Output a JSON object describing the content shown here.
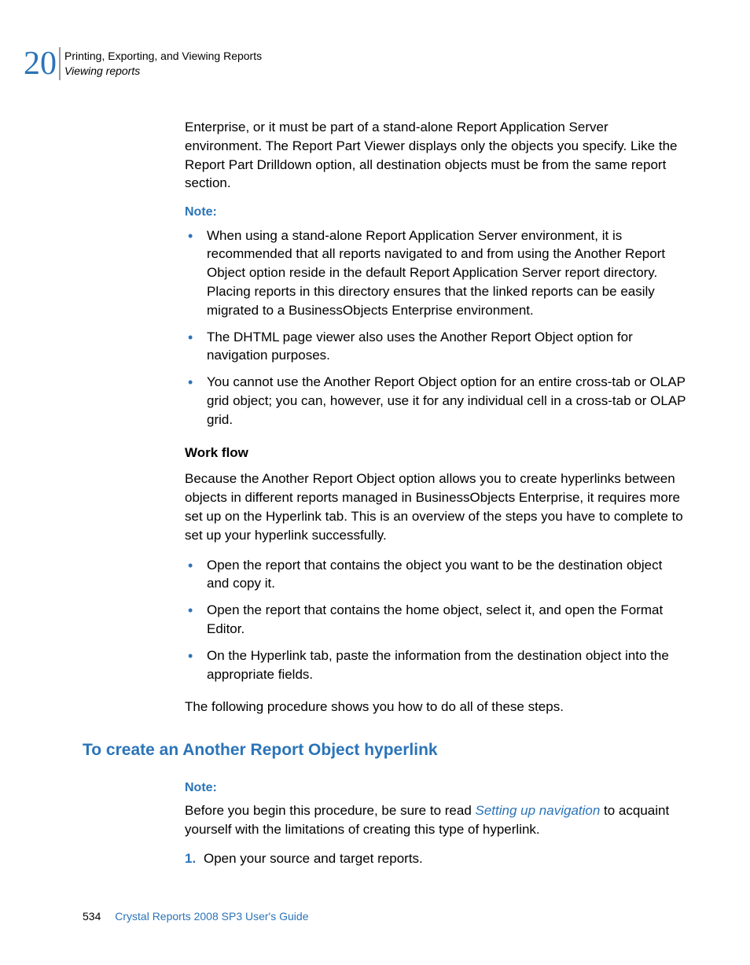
{
  "header": {
    "chapter_number": "20",
    "title": "Printing, Exporting, and Viewing Reports",
    "subtitle": "Viewing reports"
  },
  "body": {
    "intro": "Enterprise, or it must be part of a stand-alone Report Application Server environment. The Report Part Viewer displays only the objects you specify. Like the Report Part Drilldown option, all destination objects must be from the same report section.",
    "note1_label": "Note:",
    "note1_items": [
      "When using a stand-alone Report Application Server environment, it is recommended that all reports navigated to and from using the Another Report Object option reside in the default Report Application Server report directory. Placing reports in this directory ensures that the linked reports can be easily migrated to a BusinessObjects Enterprise environment.",
      "The DHTML page viewer also uses the Another Report Object option for navigation purposes.",
      "You cannot use the Another Report Object option for an entire cross-tab or OLAP grid object; you can, however, use it for any individual cell in a cross-tab or OLAP grid."
    ],
    "workflow_heading": "Work flow",
    "workflow_intro": "Because the Another Report Object option allows you to create hyperlinks between objects in different reports managed in BusinessObjects Enterprise, it requires more set up on the Hyperlink tab. This is an overview of the steps you have to complete to set up your hyperlink successfully.",
    "workflow_items": [
      "Open the report that contains the object you want to be the destination object and copy it.",
      "Open the report that contains the home object, select it, and open the Format Editor.",
      "On the Hyperlink tab, paste the information from the destination object into the appropriate fields."
    ],
    "workflow_outro": "The following procedure shows you how to do all of these steps.",
    "section_heading": "To create an Another Report Object hyperlink",
    "note2_label": "Note:",
    "note2_before": "Before you begin this procedure, be sure to read ",
    "note2_link": "Setting up navigation",
    "note2_after": " to acquaint yourself with the limitations of creating this type of hyperlink.",
    "steps": [
      {
        "num": "1.",
        "text": "Open your source and target reports."
      }
    ]
  },
  "footer": {
    "page": "534",
    "guide": "Crystal Reports 2008 SP3 User's Guide"
  }
}
